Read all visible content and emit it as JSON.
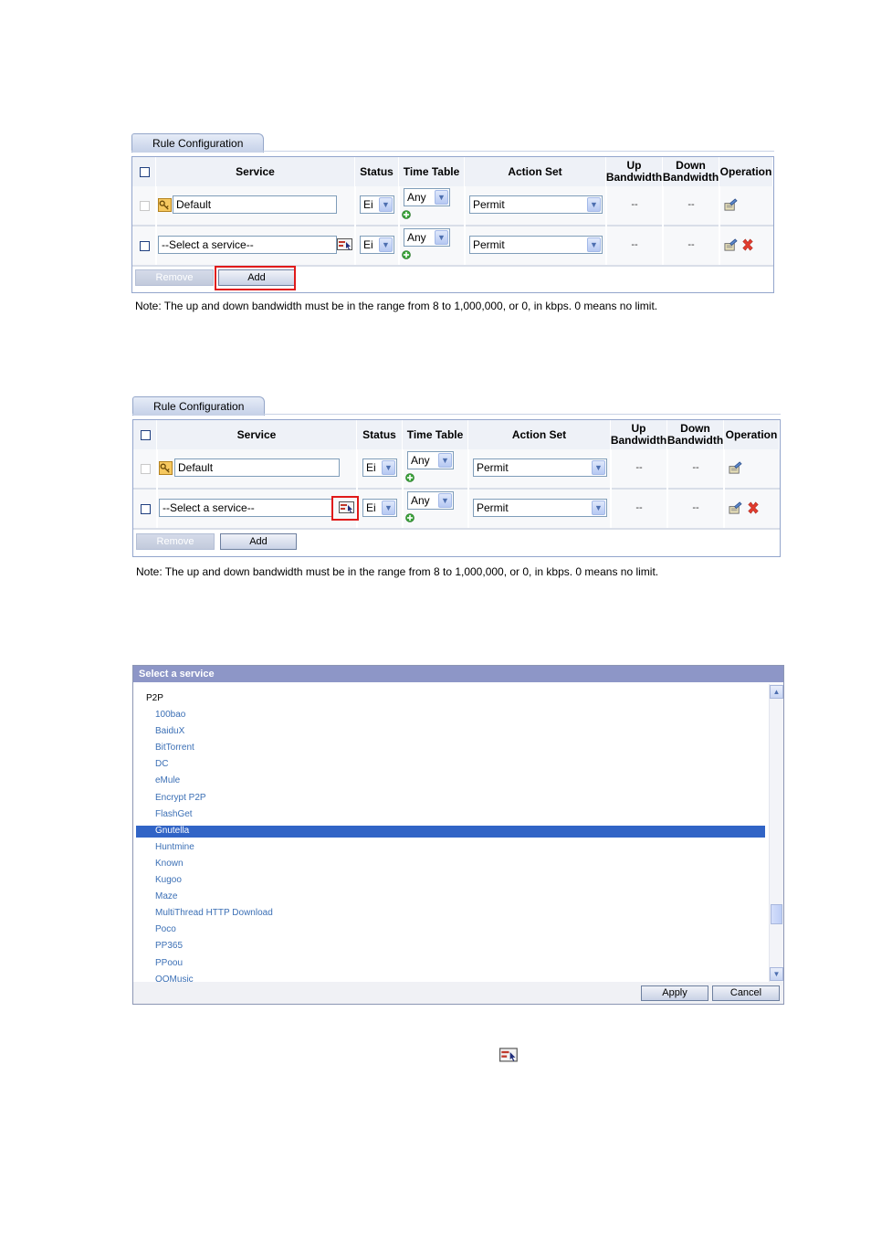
{
  "rule_config": {
    "tab_label": "Rule Configuration",
    "headers": {
      "service": "Service",
      "status": "Status",
      "time_table": "Time Table",
      "action_set": "Action Set",
      "up_bw_1": "Up",
      "up_bw_2": "Bandwidth",
      "down_bw_1": "Down",
      "down_bw_2": "Bandwidth",
      "operation": "Operation"
    },
    "row1": {
      "service": "Default",
      "status": "Ei",
      "time_table": "Any",
      "action": "Permit",
      "up": "--",
      "down": "--"
    },
    "row2": {
      "service": "--Select a service--",
      "status": "Ei",
      "time_table": "Any",
      "action": "Permit",
      "up": "--",
      "down": "--"
    },
    "remove_label": "Remove",
    "add_label": "Add",
    "note": "Note: The up and down bandwidth must be in the range from 8 to 1,000,000, or 0, in kbps. 0 means no limit."
  },
  "dialog": {
    "title": "Select a service",
    "group": "P2P",
    "items": [
      "100bao",
      "BaiduX",
      "BitTorrent",
      "DC",
      "eMule",
      "Encrypt P2P",
      "FlashGet",
      "Gnutella",
      "Huntmine",
      "Known",
      "Kugoo",
      "Maze",
      "MultiThread HTTP Download",
      "Poco",
      "PP365",
      "PPoou",
      "QQMusic"
    ],
    "selected_index": 7,
    "apply_label": "Apply",
    "cancel_label": "Cancel"
  },
  "colors": {
    "header_bg": "#eef1f7",
    "frame_border": "#93a5cc",
    "highlight": "#3164c6",
    "link": "#3b6fb5",
    "red_box": "#e01a1a"
  },
  "icons": [
    "edit-icon",
    "delete-icon",
    "service-picker-icon",
    "key-icon",
    "plus-icon"
  ]
}
